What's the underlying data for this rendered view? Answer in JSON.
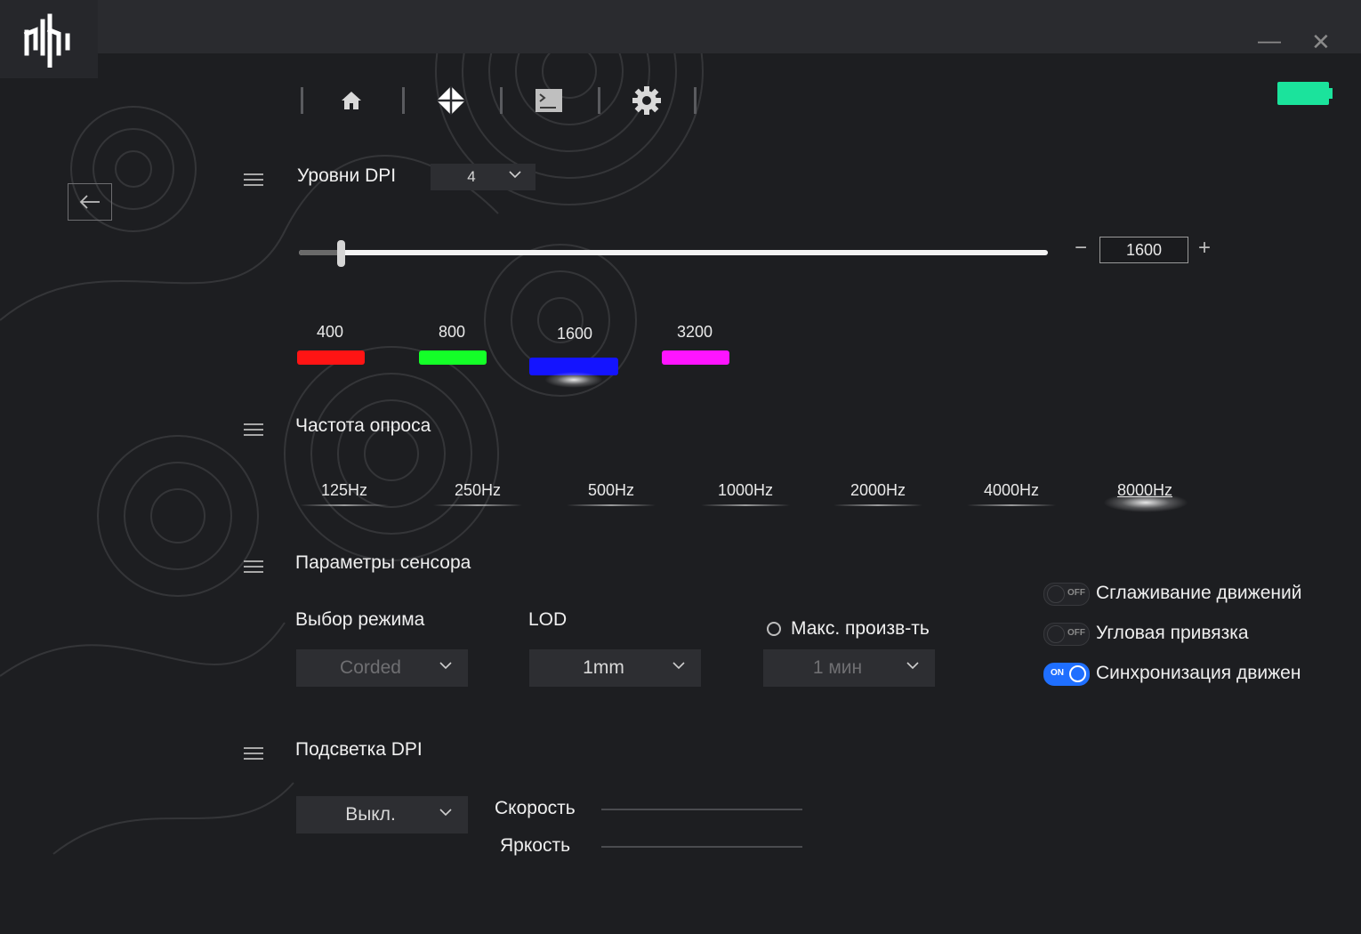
{
  "window": {
    "minimize_glyph": "—",
    "close_glyph": "✕"
  },
  "nav": {
    "items": [
      "home-icon",
      "diamond-icon",
      "terminal-icon",
      "gear-icon"
    ]
  },
  "battery": {
    "level": 1.0,
    "color": "#1be39c"
  },
  "dpi_levels": {
    "title": "Уровни DPI",
    "count": "4",
    "current_value": "1600",
    "minus": "−",
    "plus": "+",
    "slider_fraction": 0.057,
    "stages": [
      {
        "label": "400",
        "color": "#ff1414"
      },
      {
        "label": "800",
        "color": "#14ff28"
      },
      {
        "label": "1600",
        "color": "#1414ff",
        "active": true
      },
      {
        "label": "3200",
        "color": "#ff14ff"
      }
    ]
  },
  "polling": {
    "title": "Частота опроса",
    "rates": [
      "125Hz",
      "250Hz",
      "500Hz",
      "1000Hz",
      "2000Hz",
      "4000Hz",
      "8000Hz"
    ],
    "selected": "8000Hz"
  },
  "sensor": {
    "title": "Параметры сенсора",
    "mode_label": "Выбор режима",
    "mode_value": "Corded",
    "lod_label": "LOD",
    "lod_value": "1mm",
    "perf_label": "Макс. произв-ть",
    "perf_value": "1 мин",
    "toggles": [
      {
        "label": "Сглаживание движений",
        "state": "OFF"
      },
      {
        "label": "Угловая привязка",
        "state": "OFF"
      },
      {
        "label": "Синхронизация движен",
        "state": "ON"
      }
    ]
  },
  "dpi_light": {
    "title": "Подсветка DPI",
    "mode_value": "Выкл.",
    "speed_label": "Скорость",
    "brightness_label": "Яркость"
  }
}
